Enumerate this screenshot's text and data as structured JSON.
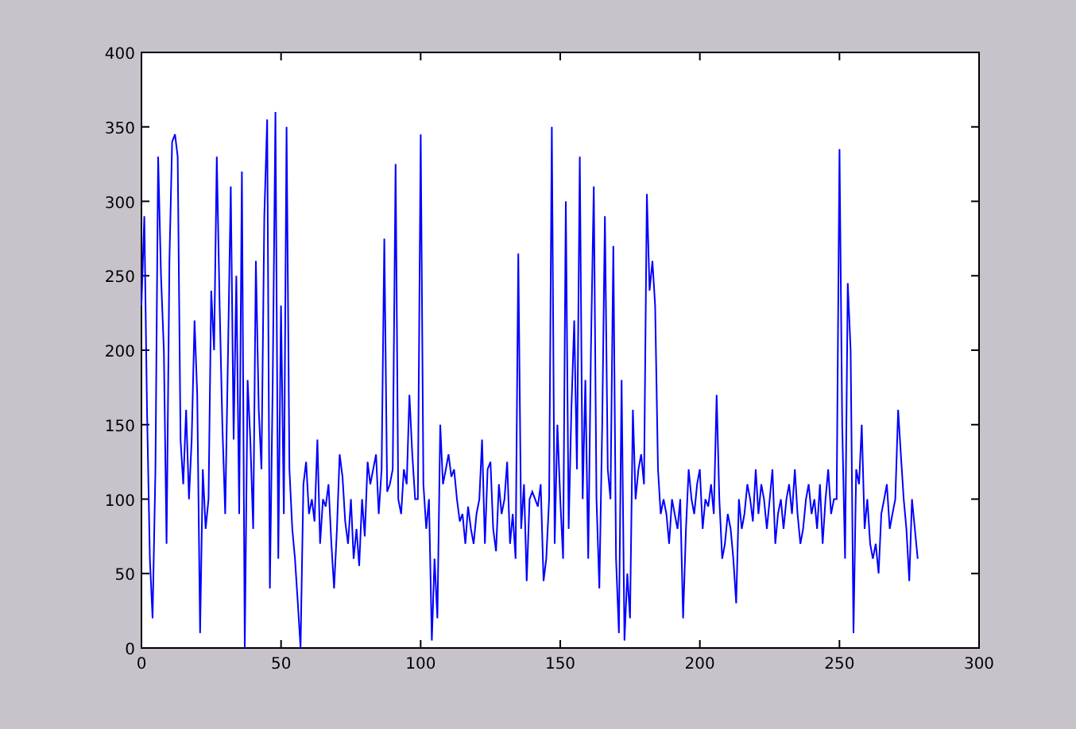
{
  "figure": {
    "chart_data": {
      "type": "line",
      "xlim": [
        0,
        300
      ],
      "ylim": [
        0,
        400
      ],
      "xticks": [
        0,
        50,
        100,
        150,
        200,
        250,
        300
      ],
      "x": [
        0,
        1,
        2,
        3,
        4,
        5,
        6,
        7,
        8,
        9,
        10,
        11,
        12,
        13,
        14,
        15,
        16,
        17,
        18,
        19,
        20,
        21,
        22,
        23,
        24,
        25,
        26,
        27,
        28,
        29,
        30,
        31,
        32,
        33,
        34,
        35,
        36,
        37,
        38,
        39,
        40,
        41,
        42,
        43,
        44,
        45,
        46,
        47,
        48,
        49,
        50,
        51,
        52,
        53,
        54,
        55,
        56,
        57,
        58,
        59,
        60,
        61,
        62,
        63,
        64,
        65,
        66,
        67,
        68,
        69,
        70,
        71,
        72,
        73,
        74,
        75,
        76,
        77,
        78,
        79,
        80,
        81,
        82,
        83,
        84,
        85,
        86,
        87,
        88,
        89,
        90,
        91,
        92,
        93,
        94,
        95,
        96,
        97,
        98,
        99,
        100,
        101,
        102,
        103,
        104,
        105,
        106,
        107,
        108,
        109,
        110,
        111,
        112,
        113,
        114,
        115,
        116,
        117,
        118,
        119,
        120,
        121,
        122,
        123,
        124,
        125,
        126,
        127,
        128,
        129,
        130,
        131,
        132,
        133,
        134,
        135,
        136,
        137,
        138,
        139,
        140,
        141,
        142,
        143,
        144,
        145,
        146,
        147,
        148,
        149,
        150,
        151,
        152,
        153,
        154,
        155,
        156,
        157,
        158,
        159,
        160,
        161,
        162,
        163,
        164,
        165,
        166,
        167,
        168,
        169,
        170,
        171,
        172,
        173,
        174,
        175,
        176,
        177,
        178,
        179,
        180,
        181,
        182,
        183,
        184,
        185,
        186,
        187,
        188,
        189,
        190,
        191,
        192,
        193,
        194,
        195,
        196,
        197,
        198,
        199,
        200,
        201,
        202,
        203,
        204,
        205,
        206,
        207,
        208,
        209,
        210,
        211,
        212,
        213,
        214,
        215,
        216,
        217,
        218,
        219,
        220,
        221,
        222,
        223,
        224,
        225,
        226,
        227,
        228,
        229,
        230,
        231,
        232,
        233,
        234,
        235,
        236,
        237,
        238,
        239,
        240,
        241,
        242,
        243,
        244,
        245,
        246,
        247,
        248,
        249,
        250,
        251,
        252,
        253,
        254,
        255,
        256,
        257,
        258,
        259,
        260,
        261,
        262,
        263,
        264,
        265,
        266,
        267,
        268,
        269,
        270,
        271,
        272,
        273,
        274,
        275,
        276,
        277,
        278
      ],
      "yticks": [
        0,
        50,
        100,
        150,
        200,
        250,
        300,
        350,
        400
      ],
      "series": [
        {
          "color": "#0000ff",
          "values": [
            230,
            290,
            160,
            60,
            20,
            120,
            330,
            250,
            200,
            70,
            260,
            340,
            345,
            330,
            140,
            110,
            160,
            100,
            140,
            220,
            170,
            10,
            120,
            80,
            100,
            240,
            200,
            330,
            230,
            150,
            90,
            200,
            310,
            140,
            250,
            90,
            320,
            0,
            180,
            140,
            80,
            260,
            160,
            120,
            290,
            355,
            40,
            180,
            360,
            60,
            230,
            90,
            350,
            120,
            80,
            60,
            30,
            0,
            110,
            125,
            90,
            100,
            85,
            140,
            70,
            100,
            95,
            110,
            70,
            40,
            80,
            130,
            115,
            85,
            70,
            100,
            60,
            80,
            55,
            100,
            75,
            125,
            110,
            120,
            130,
            90,
            120,
            275,
            105,
            110,
            120,
            325,
            100,
            90,
            120,
            110,
            170,
            130,
            100,
            100,
            345,
            110,
            80,
            100,
            5,
            60,
            20,
            150,
            110,
            120,
            130,
            115,
            120,
            100,
            85,
            90,
            70,
            95,
            80,
            70,
            90,
            100,
            140,
            70,
            120,
            125,
            80,
            65,
            110,
            90,
            100,
            125,
            70,
            90,
            60,
            265,
            80,
            110,
            45,
            100,
            105,
            100,
            95,
            110,
            45,
            60,
            100,
            350,
            70,
            150,
            100,
            60,
            300,
            80,
            160,
            220,
            120,
            330,
            100,
            180,
            60,
            200,
            310,
            100,
            40,
            150,
            290,
            120,
            100,
            270,
            60,
            10,
            180,
            5,
            50,
            20,
            160,
            100,
            120,
            130,
            110,
            305,
            240,
            260,
            230,
            120,
            90,
            100,
            90,
            70,
            100,
            90,
            80,
            100,
            20,
            80,
            120,
            100,
            90,
            110,
            120,
            80,
            100,
            95,
            110,
            90,
            170,
            100,
            60,
            70,
            90,
            80,
            60,
            30,
            100,
            80,
            90,
            110,
            100,
            85,
            120,
            90,
            110,
            100,
            80,
            100,
            120,
            70,
            90,
            100,
            80,
            100,
            110,
            90,
            120,
            90,
            70,
            80,
            100,
            110,
            90,
            100,
            80,
            110,
            70,
            100,
            120,
            90,
            100,
            100,
            335,
            150,
            60,
            245,
            200,
            10,
            120,
            110,
            150,
            80,
            100,
            70,
            60,
            70,
            50,
            90,
            100,
            110,
            80,
            90,
            100,
            160,
            130,
            100,
            80,
            45,
            100,
            80,
            60
          ]
        }
      ]
    }
  }
}
